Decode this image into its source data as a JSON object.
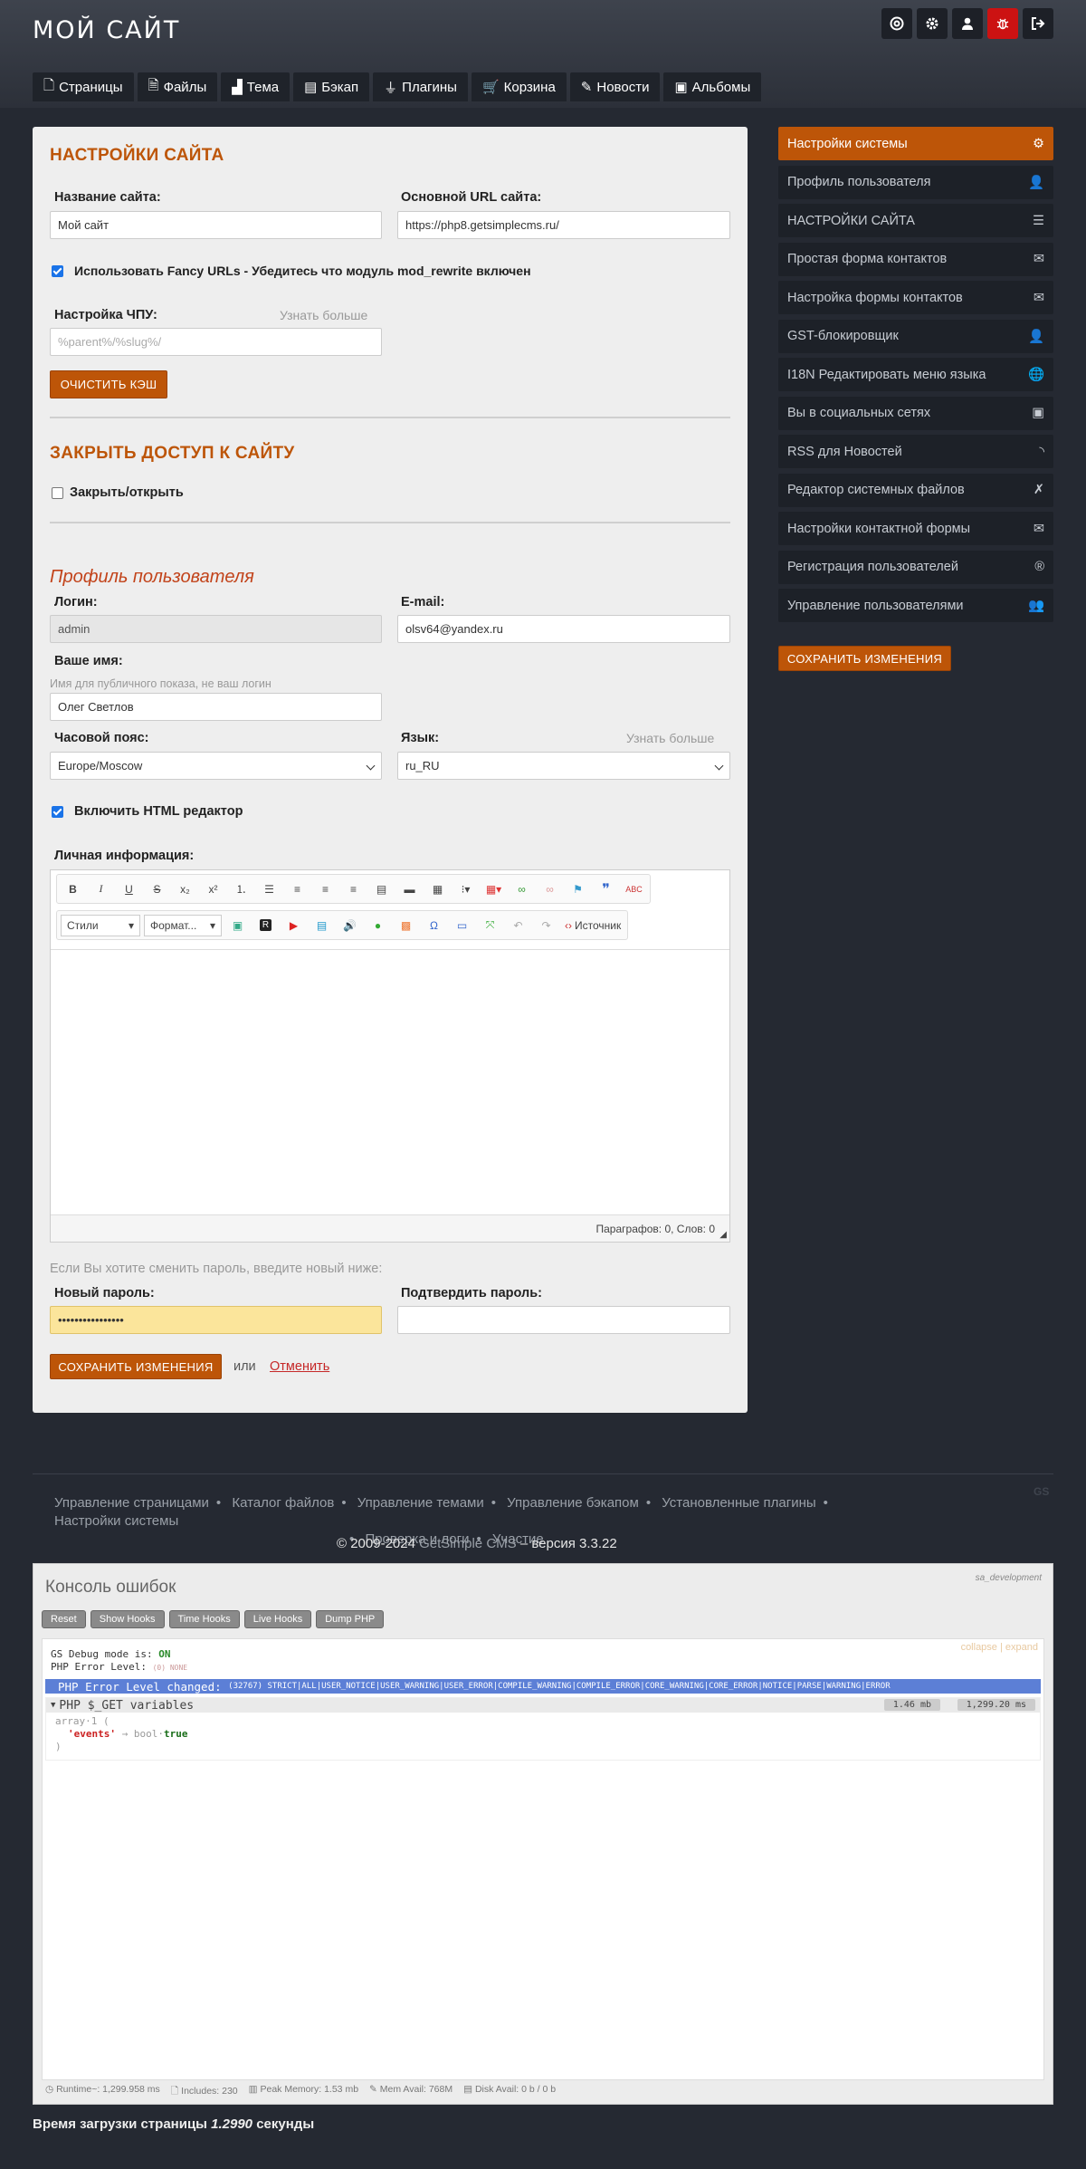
{
  "header": {
    "site_title": "МОЙ САЙТ",
    "icons": [
      "support-icon",
      "gear-icon",
      "user-icon",
      "bug-icon",
      "logout-icon"
    ]
  },
  "nav": {
    "tabs": [
      {
        "label": "Страницы",
        "icon": "page-icon"
      },
      {
        "label": "Файлы",
        "icon": "file-icon"
      },
      {
        "label": "Тема",
        "icon": "theme-icon"
      },
      {
        "label": "Бэкап",
        "icon": "backup-icon"
      },
      {
        "label": "Плагины",
        "icon": "plug-icon"
      },
      {
        "label": "Корзина",
        "icon": "cart-icon"
      },
      {
        "label": "Новости",
        "icon": "edit-icon"
      },
      {
        "label": "Альбомы",
        "icon": "image-icon"
      }
    ]
  },
  "settings": {
    "title": "НАСТРОЙКИ САЙТА",
    "site_name_label": "Название сайта:",
    "site_name_value": "Мой сайт",
    "base_url_label": "Основной URL сайта:",
    "base_url_value": "https://php8.getsimplecms.ru/",
    "fancy_urls_label": "Использовать Fancy URLs - Убедитесь что модуль mod_rewrite включен",
    "fancy_urls_checked": true,
    "permalink_label": "Настройка ЧПУ:",
    "permalink_more": "Узнать больше",
    "permalink_placeholder": "%parent%/%slug%/",
    "clear_cache_button": "ОЧИСТИТЬ КЭШ"
  },
  "maintenance": {
    "title": "ЗАКРЫТЬ ДОСТУП К САЙТУ",
    "toggle_label": "Закрыть/открыть",
    "checked": false
  },
  "profile": {
    "title": "Профиль пользователя",
    "login_label": "Логин:",
    "login_value": "admin",
    "email_label": "E-mail:",
    "email_value": "olsv64@yandex.ru",
    "name_label": "Ваше имя:",
    "name_hint": "Имя для публичного показа, не ваш логин",
    "name_value": "Олег Светлов",
    "timezone_label": "Часовой пояс:",
    "timezone_value": "Europe/Moscow",
    "lang_label": "Язык:",
    "lang_more": "Узнать больше",
    "lang_value": "ru_RU",
    "html_editor_label": "Включить HTML редактор",
    "html_editor_checked": true,
    "bio_label": "Личная информация:",
    "editor_styles": "Стили",
    "editor_format": "Формат...",
    "editor_source": "Источник",
    "editor_status": "Параграфов: 0, Слов: 0",
    "password_hint": "Если Вы хотите сменить пароль, введите новый ниже:",
    "new_password_label": "Новый пароль:",
    "new_password_value": "••••••••••••••••",
    "confirm_password_label": "Подтвердить пароль:",
    "save_button": "СОХРАНИТЬ ИЗМЕНЕНИЯ",
    "or_text": "или",
    "cancel_link": "Отменить"
  },
  "sidebar": {
    "items": [
      {
        "label": "Настройки системы",
        "icon": "gear-icon",
        "active": true
      },
      {
        "label": "Профиль пользователя",
        "icon": "user-icon"
      },
      {
        "label": "НАСТРОЙКИ САЙТА",
        "icon": "sliders-icon"
      },
      {
        "label": "Простая форма контактов",
        "icon": "envelope-icon"
      },
      {
        "label": "Настройка формы контактов",
        "icon": "envelope-icon"
      },
      {
        "label": "GST-блокировщик",
        "icon": "user-lock-icon"
      },
      {
        "label": "I18N Редактировать меню языка",
        "icon": "globe-icon"
      },
      {
        "label": "Вы в социальных сетях",
        "icon": "id-card-icon"
      },
      {
        "label": "RSS для Новостей",
        "icon": "rss-icon"
      },
      {
        "label": "Редактор системных файлов",
        "icon": "tools-icon"
      },
      {
        "label": "Настройки контактной формы",
        "icon": "envelope-icon"
      },
      {
        "label": "Регистрация пользователей",
        "icon": "registered-icon"
      },
      {
        "label": "Управление пользователями",
        "icon": "users-icon"
      }
    ],
    "save_button": "СОХРАНИТЬ ИЗМЕНЕНИЯ"
  },
  "footer": {
    "links": [
      "Управление страницами",
      "Каталог файлов",
      "Управление темами",
      "Управление бэкапом",
      "Установленные плагины",
      "Настройки системы",
      "Проверка и логи",
      "Участие"
    ],
    "gs_badge": "GS",
    "copyright_prefix": "© 2009-2024 ",
    "cms_name": "GetSimple CMS",
    "version_text": " – версия 3.3.22"
  },
  "console": {
    "title": "Консоль ошибок",
    "mode": "sa_development",
    "buttons": [
      "Reset",
      "Show Hooks",
      "Time Hooks",
      "Live Hooks",
      "Dump PHP"
    ],
    "collapse": "collapse",
    "expand": "expand",
    "debug_mode_text": "GS Debug mode is:",
    "debug_mode_value": "ON",
    "error_level_text": "PHP Error Level:",
    "error_level_value": "(0) NONE",
    "level_changed_title": "PHP Error Level changed:",
    "level_changed_value": "(32767) STRICT|ALL|USER_NOTICE|USER_WARNING|USER_ERROR|COMPILE_WARNING|COMPILE_ERROR|CORE_WARNING|CORE_ERROR|NOTICE|PARSE|WARNING|ERROR",
    "get_vars_title": "PHP $_GET variables",
    "memory": "1.46 mb",
    "time": "1,299.20 ms",
    "dump_line1": "array·1 (",
    "dump_key": "'events'",
    "dump_arrow": " → bool·",
    "dump_val": "true",
    "dump_end": ")",
    "stats": {
      "runtime": "Runtime~: 1,299.958 ms",
      "includes": "Includes: 230",
      "peak": "Peak Memory: 1.53 mb",
      "mem": "Mem Avail: 768M",
      "disk": "Disk Avail: 0 b / 0 b"
    }
  },
  "load_time": {
    "prefix": "Время загрузки страницы ",
    "value": "1.2990",
    "suffix": " секунды"
  },
  "colors": {
    "accent": "#bd5508",
    "dark": "#252932",
    "sidebar": "#1d2128"
  }
}
